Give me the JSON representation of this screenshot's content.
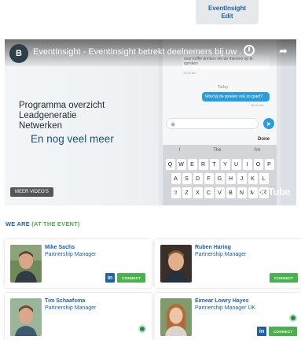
{
  "edit_badge": {
    "line1": "EventInsight",
    "line2": "Edit"
  },
  "video": {
    "channel_initial": "B",
    "title": "EventInsight - EventInsight betrekt deelnemers bij uw ...",
    "lines": [
      "Programma overzicht",
      "Leadgeneratie",
      "Netwerken"
    ],
    "highlight": "En nog veel meer",
    "more_videos": "MEER VIDEO'S",
    "youtube": "YouTube",
    "phone": {
      "chat_text": "voor koffie drinken om de mensen op te spreken",
      "time1": "10:20 am",
      "day": "Today",
      "bubble": "Word jij de spreker ook zo goed?",
      "time2": "08:40 am",
      "done": "Done",
      "suggestions": [
        "I",
        "The",
        "I'm"
      ],
      "row1": [
        "Q",
        "W",
        "E",
        "R",
        "T",
        "Y",
        "U",
        "I",
        "O",
        "P"
      ],
      "row2": [
        "A",
        "S",
        "D",
        "F",
        "G",
        "H",
        "J",
        "K",
        "L"
      ],
      "row3": [
        "⇧",
        "Z",
        "X",
        "C",
        "V",
        "B",
        "N",
        "M",
        "⌫"
      ]
    }
  },
  "we_are": {
    "prefix": "WE ARE",
    "suffix": "(AT THE EVENT)"
  },
  "people": [
    {
      "name": "Mike Sachs",
      "title": "Partnership Manager",
      "linkedin": "in",
      "connect": "CONNECT"
    },
    {
      "name": "Ruben Haring",
      "title": "Partnership Manager",
      "connect": "CONNECT"
    },
    {
      "name": "Tim Schaafsma",
      "title": "Partnership Manager"
    },
    {
      "name": "Eimear Lowry Hayes",
      "title": "Partnership Manager UK",
      "linkedin": "in",
      "connect": "CONNECT"
    }
  ],
  "colors": {
    "primary": "#1f5fa8",
    "accent": "#4caf50",
    "linkedin": "#1f5fa8"
  }
}
